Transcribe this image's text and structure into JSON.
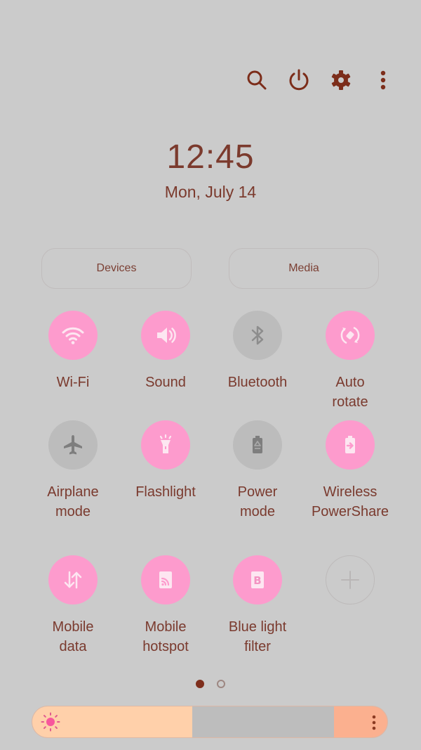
{
  "header": {
    "icons": [
      {
        "name": "search-icon",
        "label": "Search"
      },
      {
        "name": "power-icon",
        "label": "Power"
      },
      {
        "name": "gear-icon",
        "label": "Settings"
      },
      {
        "name": "more-vert-icon",
        "label": "More options"
      }
    ]
  },
  "clock": {
    "time": "12:45",
    "date": "Mon, July 14"
  },
  "buttons": {
    "devices": "Devices",
    "media": "Media"
  },
  "tiles": [
    {
      "label": "Wi-Fi",
      "icon": "wifi-icon",
      "state": "on"
    },
    {
      "label": "Sound",
      "icon": "sound-icon",
      "state": "on"
    },
    {
      "label": "Bluetooth",
      "icon": "bluetooth-icon",
      "state": "off"
    },
    {
      "label": "Auto\nrotate",
      "icon": "auto-rotate-icon",
      "state": "on"
    },
    {
      "label": "Airplane\nmode",
      "icon": "airplane-icon",
      "state": "off"
    },
    {
      "label": "Flashlight",
      "icon": "flashlight-icon",
      "state": "on"
    },
    {
      "label": "Power\nmode",
      "icon": "power-mode-icon",
      "state": "off"
    },
    {
      "label": "Wireless\nPowerShare",
      "icon": "wireless-powershare-icon",
      "state": "on"
    },
    {
      "label": "Mobile\ndata",
      "icon": "mobile-data-icon",
      "state": "on"
    },
    {
      "label": "Mobile\nhotspot",
      "icon": "mobile-hotspot-icon",
      "state": "on"
    },
    {
      "label": "Blue light\nfilter",
      "icon": "blue-light-filter-icon",
      "state": "on"
    },
    {
      "label": "",
      "icon": "add-icon",
      "state": "add"
    }
  ],
  "pagination": {
    "current_page": 1,
    "total_pages": 2
  },
  "brightness": {
    "level": 0.45
  },
  "colors": {
    "background": "#cbcbcb",
    "text": "#7a3a2e",
    "tile_on": "#fd9bcd",
    "tile_off": "#bcbcbc",
    "brightness_fill": "#ffd0aa",
    "brightness_end": "#fbb08f"
  }
}
